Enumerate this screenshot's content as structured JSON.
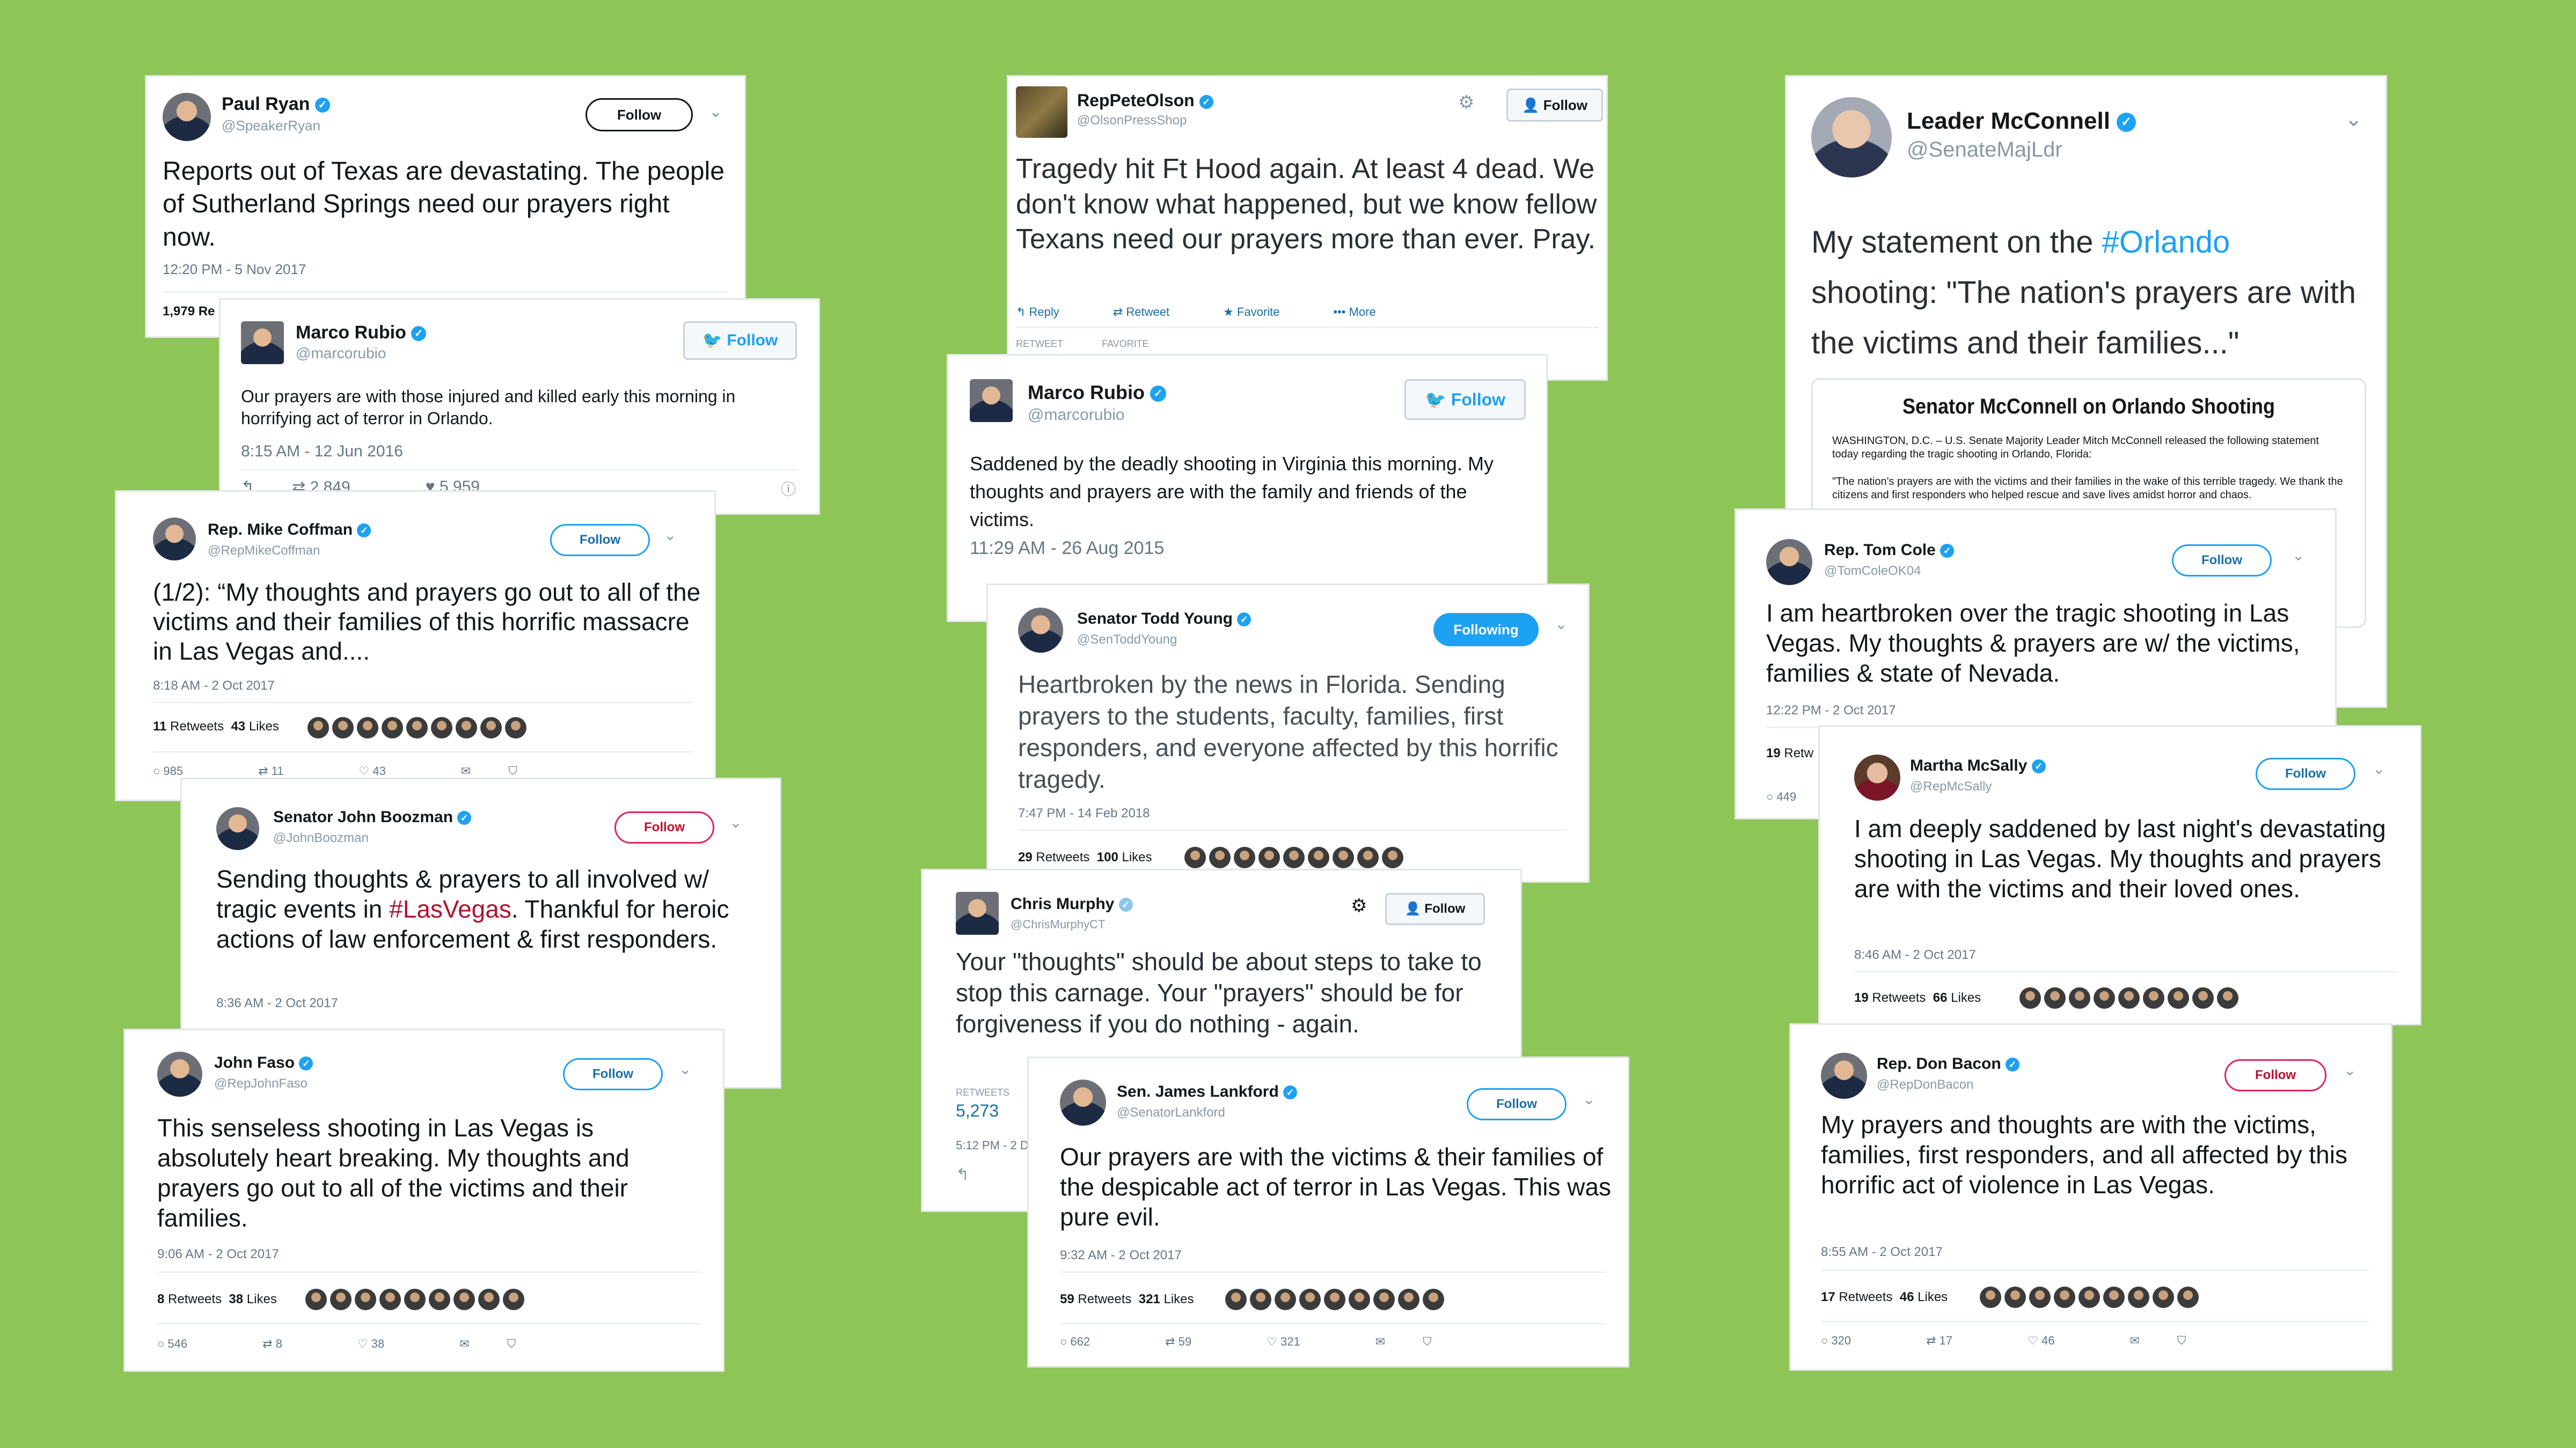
{
  "colors": {
    "background": "#8dc556",
    "twitter_blue": "#1da1f2",
    "red_follow": "#e0245e"
  },
  "ryan": {
    "name": "Paul Ryan",
    "handle": "@SpeakerRyan",
    "follow": "Follow",
    "text": "Reports out of Texas are devastating. The people of Sutherland Springs need our prayers right now.",
    "time": "12:20 PM - 5 Nov 2017",
    "stat": "1,979 Re"
  },
  "rubio1": {
    "name": "Marco Rubio",
    "handle": "@marcorubio",
    "follow": "Follow",
    "text": "Our prayers are with those injured and killed early this morning in horrifying act of terror in Orlando.",
    "time": "8:15 AM - 12 Jun 2016",
    "retweets": "2,849",
    "likes": "5,959"
  },
  "coffman": {
    "name": "Rep. Mike Coffman",
    "handle": "@RepMikeCoffman",
    "follow": "Follow",
    "text": "(1/2): “My thoughts and prayers go out to all of the victims and their families of this horrific massacre in Las Vegas and....",
    "time": "8:18 AM - 2 Oct 2017",
    "retweets": "11",
    "retweets_label": "Retweets",
    "likes": "43",
    "likes_label": "Likes",
    "replies": "985",
    "rt": "11",
    "lk": "43"
  },
  "boozman": {
    "name": "Senator John Boozman",
    "handle": "@JohnBoozman",
    "follow": "Follow",
    "text_pre": "Sending thoughts & prayers to all involved w/ tragic events in ",
    "hashtag": "#LasVegas",
    "text_post": ". Thankful for heroic actions of law enforcement & first responders.",
    "time": "8:36 AM - 2 Oct 2017"
  },
  "faso": {
    "name": "John Faso",
    "handle": "@RepJohnFaso",
    "follow": "Follow",
    "text": "This senseless shooting in Las Vegas is absolutely heart breaking. My thoughts and prayers go out to all of the victims and their families.",
    "time": "9:06 AM - 2 Oct 2017",
    "retweets": "8",
    "retweets_label": "Retweets",
    "likes": "38",
    "likes_label": "Likes",
    "replies": "546",
    "rt": "8",
    "lk": "38"
  },
  "olson": {
    "name": "RepPeteOlson",
    "handle": "@OlsonPressShop",
    "follow": "Follow",
    "text": "Tragedy hit Ft Hood again. At least 4 dead. We don't know what happened, but we know fellow Texans need our prayers more than ever. Pray.",
    "reply": "Reply",
    "retweet": "Retweet",
    "favorite": "Favorite",
    "more": "More",
    "retweets_label": "RETWEET",
    "favorites_label": "FAVORITE"
  },
  "rubio2": {
    "name": "Marco Rubio",
    "handle": "@marcorubio",
    "follow": "Follow",
    "text": "Saddened by the deadly shooting in Virginia this morning. My thoughts and prayers are with the family and friends of the victims.",
    "time": "11:29 AM - 26 Aug 2015"
  },
  "young": {
    "name": "Senator Todd Young",
    "handle": "@SenToddYoung",
    "follow": "Following",
    "text": "Heartbroken by the news in Florida. Sending prayers to the students, faculty, families, first responders, and everyone affected by this horrific tragedy.",
    "time": "7:47 PM - 14 Feb 2018",
    "retweets": "29",
    "retweets_label": "Retweets",
    "likes": "100",
    "likes_label": "Likes"
  },
  "murphy": {
    "name": "Chris Murphy",
    "handle": "@ChrisMurphyCT",
    "follow": "Follow",
    "text": "Your \"thoughts\" should be about steps to take to stop this carnage. Your \"prayers\" should be for forgiveness if you do nothing - again.",
    "retweets_label": "RETWEETS",
    "retweets": "5,273",
    "time": "5:12 PM - 2 D"
  },
  "lankford": {
    "name": "Sen. James Lankford",
    "handle": "@SenatorLankford",
    "follow": "Follow",
    "text": "Our prayers are with the victims & their families of the despicable act of terror in Las Vegas. This was pure evil.",
    "time": "9:32 AM - 2 Oct 2017",
    "retweets": "59",
    "retweets_label": "Retweets",
    "likes": "321",
    "likes_label": "Likes",
    "replies": "662",
    "rt": "59",
    "lk": "321"
  },
  "mcconnell": {
    "name": "Leader McConnell",
    "handle": "@SenateMajLdr",
    "text_pre": "My statement on the ",
    "hashtag": "#Orlando",
    "text_post": " shooting: \"The nation's prayers are with the victims and their families...\"",
    "doc_title": "Senator McConnell on Orlando Shooting",
    "doc_line1": "WASHINGTON, D.C. – U.S. Senate Majority Leader Mitch McConnell released the following statement today regarding the tragic shooting in Orlando, Florida:",
    "doc_line2": "\"The nation's prayers are with the victims and their families in the wake of this terrible tragedy. We thank the citizens and first responders who helped rescue and save lives amidst horror and chaos."
  },
  "cole": {
    "name": "Rep. Tom Cole",
    "handle": "@TomColeOK04",
    "follow": "Follow",
    "text": "I am heartbroken over the tragic shooting in Las Vegas. My thoughts & prayers are w/ the victims, families & state of Nevada.",
    "time": "12:22 PM - 2 Oct 2017",
    "retweets": "19",
    "retweets_label": "Retw",
    "replies": "449"
  },
  "mcsally": {
    "name": "Martha McSally",
    "handle": "@RepMcSally",
    "follow": "Follow",
    "text": "I am deeply saddened by last night's devastating shooting in Las Vegas. My thoughts and prayers are with the victims and their loved ones.",
    "time": "8:46 AM - 2 Oct 2017",
    "retweets": "19",
    "retweets_label": "Retweets",
    "likes": "66",
    "likes_label": "Likes"
  },
  "bacon": {
    "name": "Rep. Don Bacon",
    "handle": "@RepDonBacon",
    "follow": "Follow",
    "text": "My prayers and thoughts are with the victims, families, first responders, and all affected by this horrific act of violence in Las Vegas.",
    "time": "8:55 AM - 2 Oct 2017",
    "retweets": "17",
    "retweets_label": "Retweets",
    "likes": "46",
    "likes_label": "Likes",
    "replies": "320",
    "rt": "17",
    "lk": "46"
  }
}
